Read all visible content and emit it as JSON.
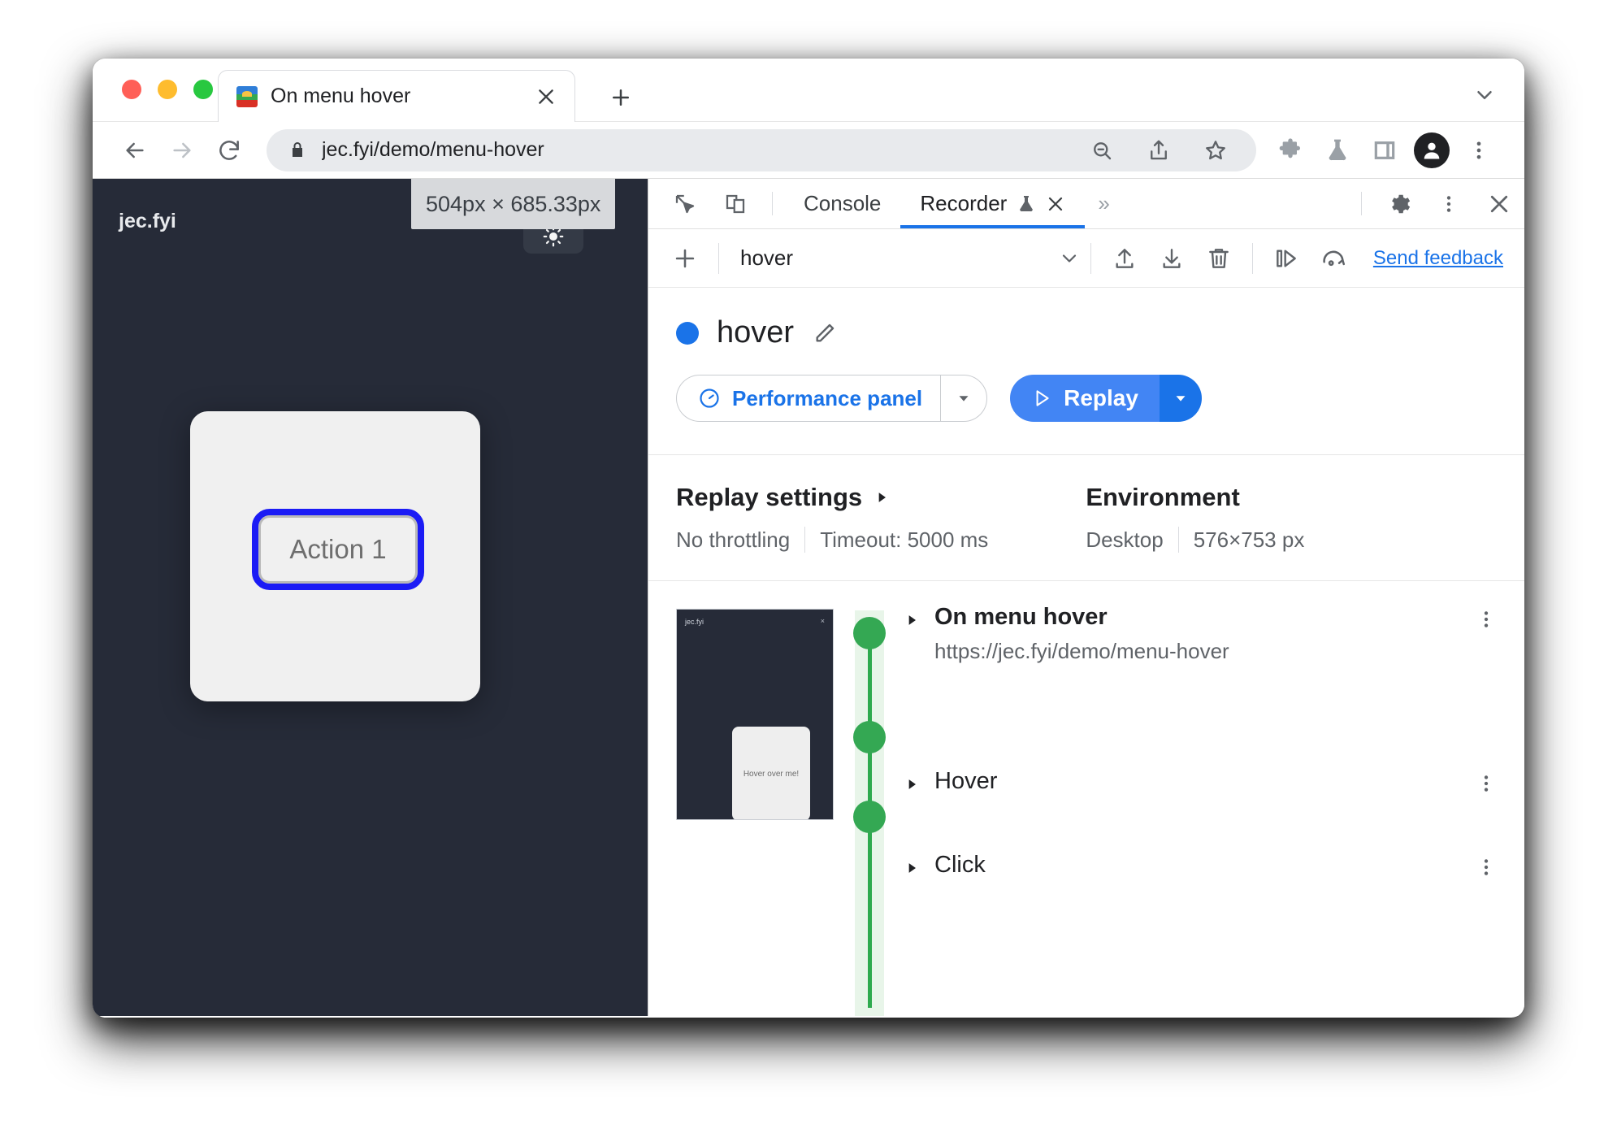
{
  "browser": {
    "tab": {
      "title": "On menu hover",
      "favicon": "site-favicon",
      "close": "×"
    },
    "new_tab": "+",
    "tab_list_caret": "⌄",
    "omnibox": {
      "url": "jec.fyi/demo/menu-hover",
      "lock": "lock-icon",
      "zoom_out": "zoom-out-icon",
      "share": "share-icon",
      "bookmark": "star-icon"
    },
    "nav": {
      "back": "←",
      "forward": "→",
      "reload": "⟳"
    },
    "actions": {
      "extensions": "puzzle-icon",
      "experiments": "flask-icon",
      "side_panel": "side-panel-icon",
      "profile": "avatar-icon",
      "menu": "kebab-icon"
    }
  },
  "page": {
    "brand": "jec.fyi",
    "action_button": "Action 1",
    "dimension_badge": "504px × 685.33px"
  },
  "devtools": {
    "tabs": [
      {
        "label": "Console",
        "active": false
      },
      {
        "label": "Recorder",
        "active": true,
        "icon": "flask-icon",
        "close": "×"
      }
    ],
    "more_tabs": "»",
    "inspect_icon": "inspect-cursor-icon",
    "device_icon": "device-toggle-icon",
    "settings_icon": "gear-icon",
    "menu_icon": "kebab-icon",
    "close_icon": "close-icon"
  },
  "recorder_toolbar": {
    "add": "+",
    "selected_recording": "hover",
    "caret": "⌄",
    "import": "import-icon",
    "export": "export-icon",
    "delete": "trash-icon",
    "step_over": "step-over-icon",
    "replay_again": "replay-arc-icon",
    "feedback": "Send feedback"
  },
  "recording": {
    "title": "hover",
    "status_color": "#1a73e8",
    "edit": "pencil-icon",
    "performance_button": "Performance panel",
    "performance_caret": "▾",
    "replay_button": "Replay",
    "replay_caret": "▾"
  },
  "settings": {
    "replay": {
      "heading": "Replay settings",
      "expand": "▶",
      "throttling": "No throttling",
      "timeout": "Timeout: 5000 ms"
    },
    "environment": {
      "heading": "Environment",
      "device": "Desktop",
      "viewport": "576×753 px"
    }
  },
  "thumbnail": {
    "brand": "jec.fyi",
    "close": "×",
    "card_text": "Hover over me!"
  },
  "steps": [
    {
      "title": "On menu hover",
      "url": "https://jec.fyi/demo/menu-hover",
      "expand": "▶",
      "menu": "⋮"
    },
    {
      "title": "Hover",
      "url": "",
      "expand": "▶",
      "menu": "⋮"
    },
    {
      "title": "Click",
      "url": "",
      "expand": "▶",
      "menu": "⋮"
    }
  ]
}
